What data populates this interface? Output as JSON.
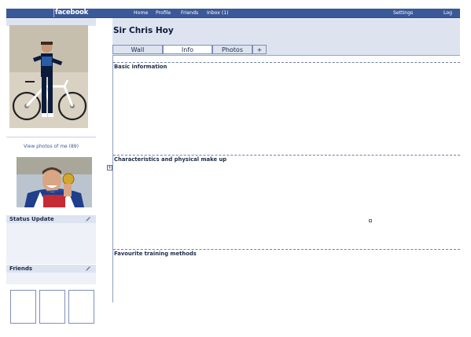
{
  "topbar": {
    "logo": "facebook",
    "nav": {
      "home": "Home",
      "profile": "Profile",
      "friends": "Friends",
      "inbox": "Inbox (1)"
    },
    "settings": "Settings",
    "logout": "Log out"
  },
  "profile": {
    "name": "Sir Chris Hoy"
  },
  "tabs": [
    {
      "label": "Wall"
    },
    {
      "label": "Info"
    },
    {
      "label": "Photos"
    },
    {
      "label": "+"
    }
  ],
  "sidebar": {
    "view_photos": "View photos of me (89)",
    "status_update": {
      "title": "Status Update"
    },
    "friends": {
      "title": "Friends"
    }
  },
  "sections": [
    {
      "title": "Basic information"
    },
    {
      "title": "Characteristics and physical make up"
    },
    {
      "title": "Favourite training methods"
    }
  ],
  "colors": {
    "brand": "#3b5998",
    "band": "#dde4f0"
  }
}
